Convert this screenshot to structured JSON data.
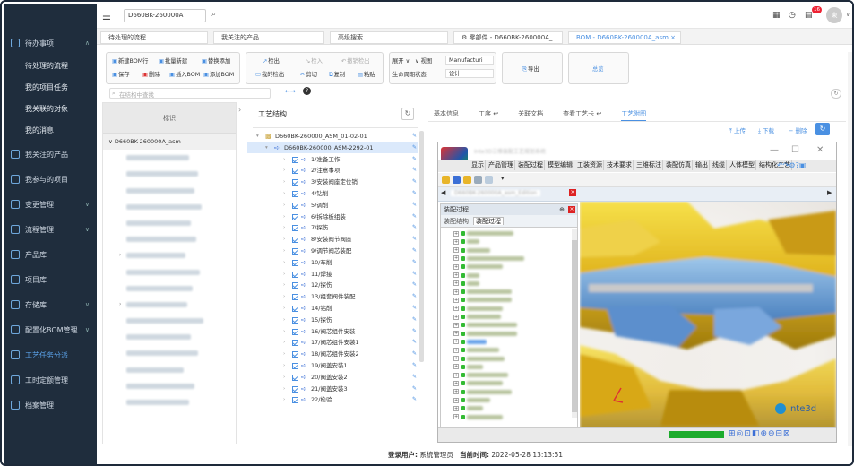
{
  "topbar": {
    "search_value": "D660BK-260000A",
    "notification_count": "16",
    "avatar_initial": "東"
  },
  "tabs": [
    {
      "label": "待处理的流程"
    },
    {
      "label": "我关注的产品"
    },
    {
      "label": "高级搜索"
    },
    {
      "label": "零部件 - D660BK-260000A_"
    },
    {
      "label": "BOM - D660BK-260000A_asm"
    }
  ],
  "sidebar": {
    "groups": [
      {
        "label": "待办事项",
        "expanded": true,
        "children": [
          "待处理的流程",
          "我的项目任务",
          "我关联的对象",
          "我的消息"
        ]
      },
      {
        "label": "我关注的产品"
      },
      {
        "label": "我参与的项目"
      },
      {
        "label": "变更管理"
      },
      {
        "label": "流程管理"
      },
      {
        "label": "产品库"
      },
      {
        "label": "项目库"
      },
      {
        "label": "存储库"
      },
      {
        "label": "配置化BOM管理"
      },
      {
        "label": "工艺任务分派"
      },
      {
        "label": "工时定额管理"
      },
      {
        "label": "档案管理"
      }
    ]
  },
  "toolbar": {
    "g1": [
      "新建BOM行",
      "批量新建",
      "替换添加",
      "保存",
      "删除",
      "插入BOM",
      "添加BOM"
    ],
    "g2": [
      "检出",
      "检入",
      "撤销检出",
      "我的检出",
      "剪切",
      "复制",
      "粘贴"
    ],
    "g3": {
      "expand": "展开",
      "view_label": "视图",
      "view_value": "Manufacturi",
      "lifecycle_label": "生命周期状态",
      "lifecycle_value": "设计"
    },
    "export": "导出",
    "more": "总览"
  },
  "search": {
    "placeholder": "在结构中查找"
  },
  "left_panel": {
    "header": "标识",
    "first_row": "D660BK-260000A_asm",
    "rows": 16
  },
  "middle": {
    "title": "工艺结构",
    "root": "D660BK-260000_ASM_01-02-01",
    "selected": "D660BK-260000_ASM-2292-01",
    "items": [
      "1/准备工作",
      "2/注意事项",
      "3/安装阀座定位销",
      "4/钻削",
      "5/调削",
      "6/拆除板组装",
      "7/探伤",
      "8/安装阀节阀座",
      "9/调节阀芯装配",
      "10/车削",
      "11/焊接",
      "12/探伤",
      "13/组套阀件装配",
      "14/钻削",
      "15/探伤",
      "16/阀芯组件安装",
      "17/阀芯组件安装1",
      "18/阀芯组件安装2",
      "19/阀盖安装1",
      "20/阀盖安装2",
      "21/阀盖安装3",
      "22/检验"
    ]
  },
  "right_panel": {
    "tabs": [
      "基本信息",
      "工序",
      "关联文档",
      "查看工艺卡",
      "工艺附图"
    ],
    "active_tab": "工艺附图",
    "actions": [
      "上传",
      "下载",
      "删除"
    ]
  },
  "viewer": {
    "title": "Inte3D三维装配工艺规划系统",
    "menu": [
      "显示",
      "产品管理",
      "装配过程",
      "模型编辑",
      "工装资源",
      "技术要求",
      "三维标注",
      "装配仿真",
      "输出",
      "线缆",
      "人体模型",
      "结构化工艺"
    ],
    "doc_tab": "D660BK-260000A_asm_Edition",
    "panel_title": "装配过程",
    "panel_tabs": [
      "装配结构",
      "装配过程"
    ],
    "brand": "Inte3d"
  },
  "footer": {
    "user_label": "登录用户:",
    "user": "系统管理员",
    "time_label": "当前时间:",
    "time": "2022-05-28 13:13:51"
  }
}
